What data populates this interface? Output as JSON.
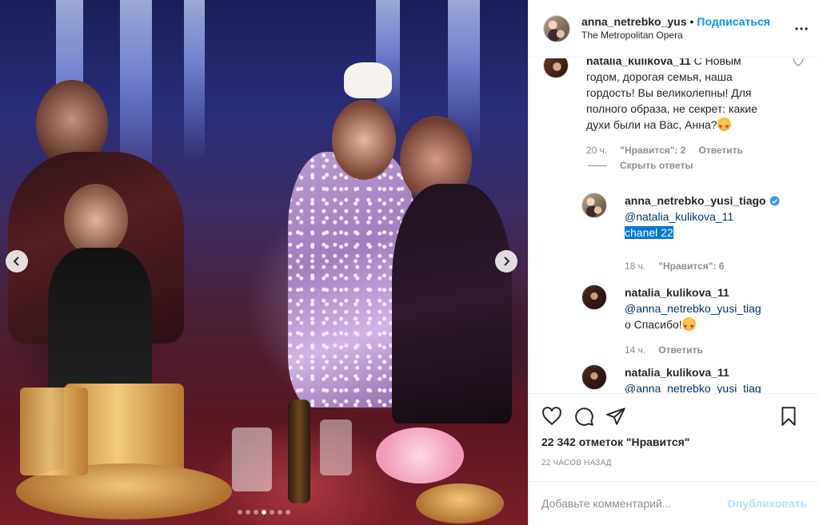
{
  "post": {
    "author": "anna_netrebko_yus",
    "separator": "•",
    "follow_label": "Подписаться",
    "location": "The Metropolitan Opera",
    "carousel": {
      "total_slides": 7,
      "active_index": 3
    }
  },
  "comments": [
    {
      "user": "natalia_kulikova_11",
      "text": "С Новым годом, дорогая семья, наша гордость! Вы великолепны! Для полного образа, не секрет: какие духи были на Вас, Анна?",
      "emoji": "heart-eyes-emoji",
      "time": "20 ч.",
      "likes": "\"Нравится\": 2",
      "reply": "Ответить"
    }
  ],
  "hide_replies": "Скрыть ответы",
  "replies": [
    {
      "user": "anna_netrebko_yusi_tiago",
      "verified": true,
      "mention": "@natalia_kulikova_11",
      "text": "chanel 22",
      "time": "18 ч.",
      "likes": "\"Нравится\": 6"
    },
    {
      "user": "natalia_kulikova_11",
      "mention": "@anna_netrebko_yusi_tiag",
      "text": "о Спасибо!",
      "emoji": "heart-eyes-emoji",
      "time": "14 ч.",
      "reply": "Ответить"
    },
    {
      "user": "natalia_kulikova_11",
      "mention": "@anna_netrebko_yusi_tiag"
    }
  ],
  "actions": {
    "like_icon": "heart-outline-icon",
    "comment_icon": "comment-icon",
    "share_icon": "share-icon",
    "save_icon": "bookmark-icon",
    "likes": "22 342 отметок \"Нравится\"",
    "timestamp": "22 ЧАСОВ НАЗАД"
  },
  "composer": {
    "placeholder": "Добавьте комментарий...",
    "publish_label": "Опубликовать"
  },
  "colors": {
    "accent": "#0095f6",
    "publish_disabled": "#b2dffc",
    "muted": "#8e8e8e",
    "selection": "#0078d7"
  }
}
